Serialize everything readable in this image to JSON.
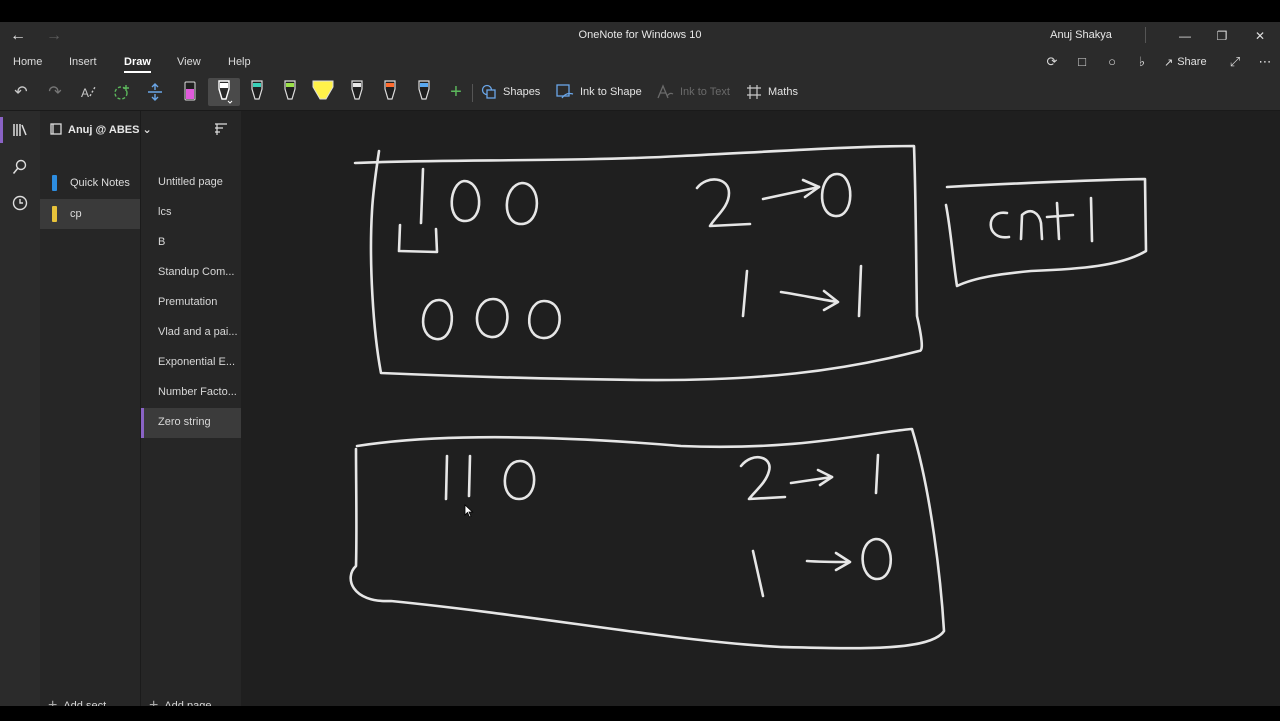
{
  "window": {
    "title": "OneNote for Windows 10",
    "user": "Anuj Shakya"
  },
  "ribbon": {
    "tabs": [
      {
        "label": "Home"
      },
      {
        "label": "Insert"
      },
      {
        "label": "Draw",
        "active": true
      },
      {
        "label": "View"
      },
      {
        "label": "Help"
      }
    ],
    "share_label": "Share"
  },
  "toolbar": {
    "shapes_label": "Shapes",
    "ink_to_shape_label": "Ink to Shape",
    "ink_to_text_label": "Ink to Text",
    "maths_label": "Maths",
    "pens": [
      {
        "color": "#e05adc"
      },
      {
        "color": "#ffffff"
      },
      {
        "color": "#39d0b8"
      },
      {
        "color": "#9be04a"
      },
      {
        "color": "#fff24a"
      },
      {
        "color": "#e8e8e8"
      },
      {
        "color": "#ff6b2e"
      },
      {
        "color": "#59a8f0"
      }
    ]
  },
  "notebook": {
    "name": "Anuj @ ABES",
    "sections": [
      {
        "label": "Quick Notes",
        "color": "#2d8de0"
      },
      {
        "label": "cp",
        "color": "#e8c33a",
        "selected": true
      }
    ],
    "pages": [
      {
        "label": "Untitled page"
      },
      {
        "label": "lcs"
      },
      {
        "label": "B"
      },
      {
        "label": "Standup Com..."
      },
      {
        "label": "Premutation"
      },
      {
        "label": "Vlad and a pai..."
      },
      {
        "label": "Exponential E..."
      },
      {
        "label": "Number Facto..."
      },
      {
        "label": "Zero string",
        "selected": true
      }
    ],
    "add_section_label": "Add sect...",
    "add_page_label": "Add page"
  },
  "canvas": {
    "ink_color": "#e6e6e6",
    "box1": {
      "left": "100",
      "left_below": "000",
      "rule1": "2 → 0",
      "rule2": "1 → 1"
    },
    "note": "cnt 1",
    "box2": {
      "left": "110",
      "rule1": "2 → 1",
      "rule2": "1 → 0"
    }
  }
}
